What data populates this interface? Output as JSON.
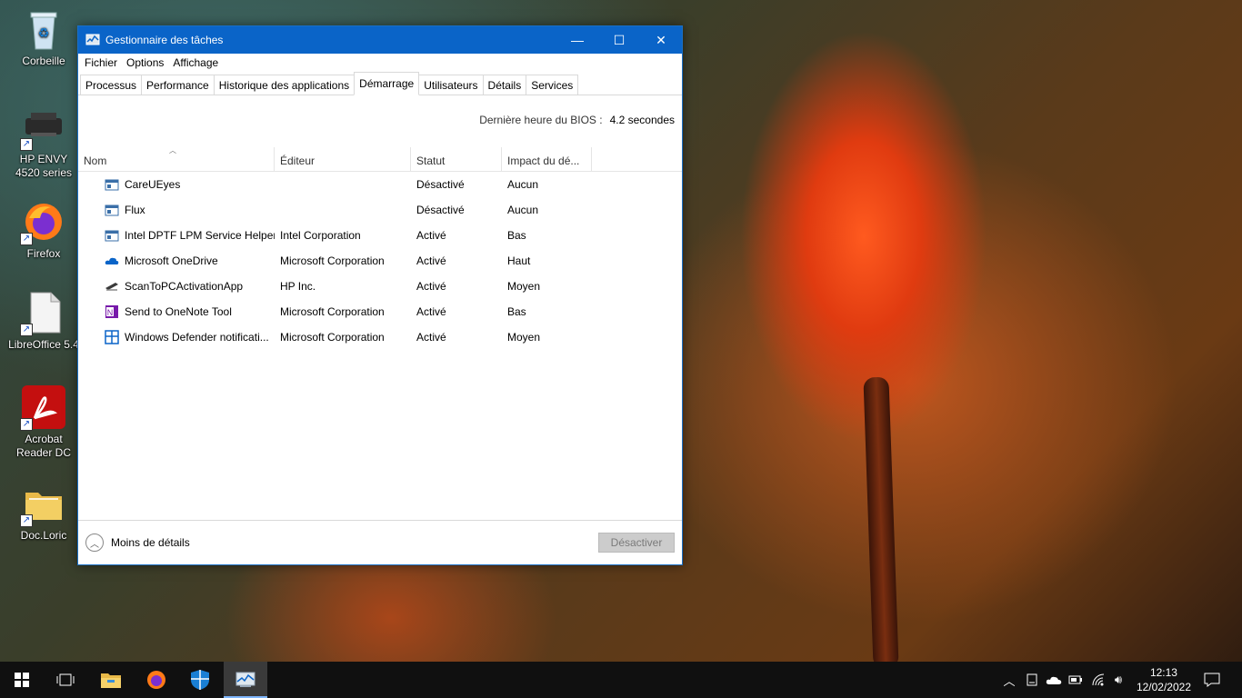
{
  "desktop": {
    "icons": [
      {
        "label": "Corbeille"
      },
      {
        "label": "HP ENVY 4520 series"
      },
      {
        "label": "Firefox"
      },
      {
        "label": "LibreOffice 5.4"
      },
      {
        "label": "Acrobat Reader DC"
      },
      {
        "label": "Doc.Loric"
      }
    ]
  },
  "window": {
    "title": "Gestionnaire des tâches",
    "menu": [
      "Fichier",
      "Options",
      "Affichage"
    ],
    "tabs": [
      "Processus",
      "Performance",
      "Historique des applications",
      "Démarrage",
      "Utilisateurs",
      "Détails",
      "Services"
    ],
    "active_tab": "Démarrage",
    "bios_label": "Dernière heure du BIOS :",
    "bios_value": "4.2 secondes",
    "columns": [
      "Nom",
      "Éditeur",
      "Statut",
      "Impact du dé..."
    ],
    "rows": [
      {
        "name": "CareUEyes",
        "publisher": "",
        "status": "Désactivé",
        "impact": "Aucun",
        "icon": "app-window-icon"
      },
      {
        "name": "Flux",
        "publisher": "",
        "status": "Désactivé",
        "impact": "Aucun",
        "icon": "app-window-icon"
      },
      {
        "name": "Intel DPTF LPM Service Helper",
        "publisher": "Intel Corporation",
        "status": "Activé",
        "impact": "Bas",
        "icon": "app-window-icon"
      },
      {
        "name": "Microsoft OneDrive",
        "publisher": "Microsoft Corporation",
        "status": "Activé",
        "impact": "Haut",
        "icon": "onedrive-cloud-icon"
      },
      {
        "name": "ScanToPCActivationApp",
        "publisher": "HP Inc.",
        "status": "Activé",
        "impact": "Moyen",
        "icon": "scanner-icon"
      },
      {
        "name": "Send to OneNote Tool",
        "publisher": "Microsoft Corporation",
        "status": "Activé",
        "impact": "Bas",
        "icon": "onenote-icon"
      },
      {
        "name": "Windows Defender notificati...",
        "publisher": "Microsoft Corporation",
        "status": "Activé",
        "impact": "Moyen",
        "icon": "defender-icon"
      }
    ],
    "footer": {
      "less_details": "Moins de détails",
      "disable_button": "Désactiver"
    }
  },
  "taskbar": {
    "time": "12:13",
    "date": "12/02/2022"
  }
}
